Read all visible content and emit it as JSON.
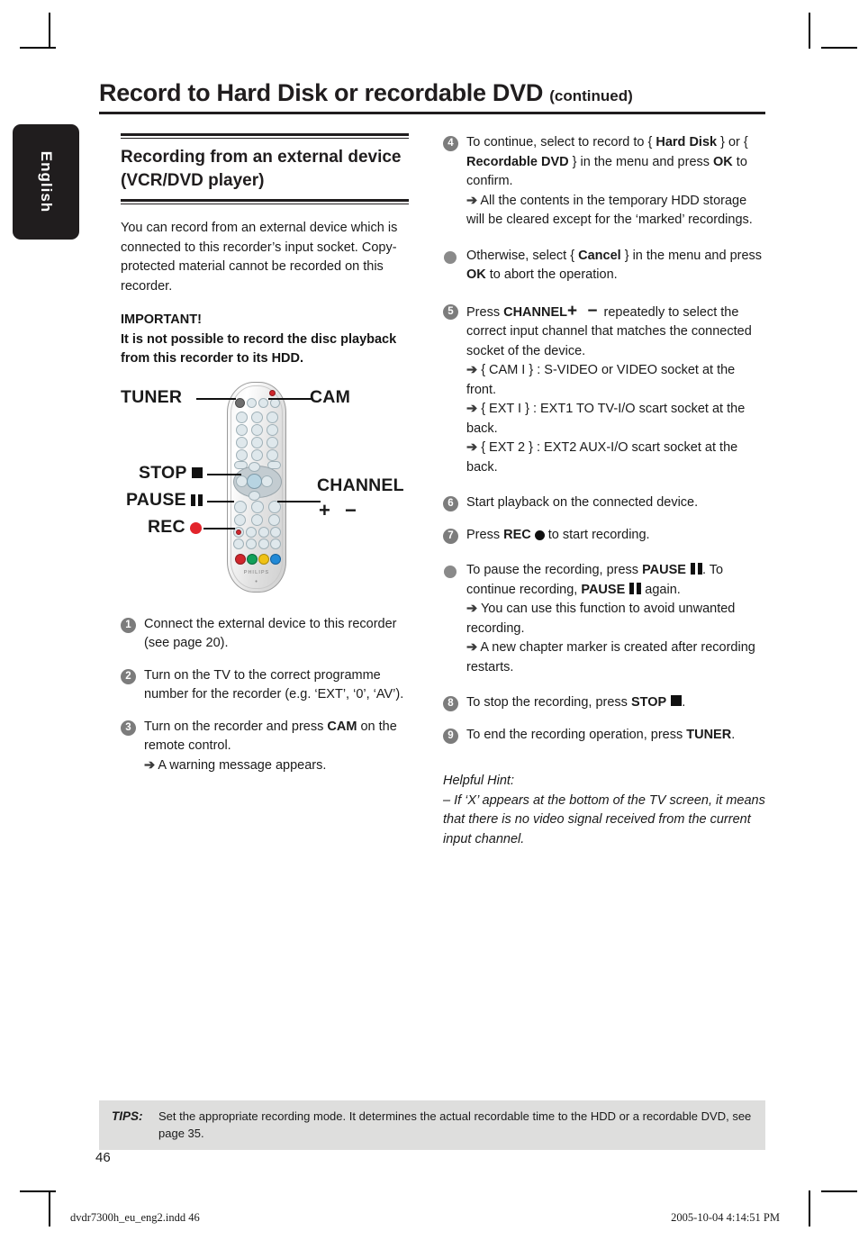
{
  "page": {
    "title": "Record to Hard Disk or recordable DVD",
    "title_suffix": "(continued)",
    "side_tab": "English",
    "page_number": "46"
  },
  "left_column": {
    "section_heading": "Recording from an external device (VCR/DVD player)",
    "intro": "You can record from an external device which is connected to this recorder’s input socket. Copy-protected material cannot be recorded on this recorder.",
    "important_label": "IMPORTANT!",
    "important_text": "It is not possible to record the disc playback from this recorder to its HDD.",
    "remote_labels": {
      "tuner": "TUNER",
      "cam": "CAM",
      "stop": "STOP",
      "pause": "PAUSE",
      "rec": "REC",
      "channel": "CHANNEL",
      "channel_plusminus": "+ −",
      "brand": "PHILIPS"
    },
    "steps": [
      {
        "number": "1",
        "text": "Connect the external device to this recorder (see page 20)."
      },
      {
        "number": "2",
        "text": "Turn on the TV to the correct programme number for the recorder (e.g. ‘EXT’, ‘0’, ‘AV’)."
      },
      {
        "number": "3",
        "text_pre": "Turn on the recorder and press ",
        "text_bold": "CAM",
        "text_post": " on the remote control.",
        "arrow_note": "A warning message appears."
      }
    ]
  },
  "right_column": {
    "step4": {
      "number": "4",
      "p1_a": "To continue, select to record to { ",
      "p1_b1": "Hard Disk",
      "p1_c": " } or { ",
      "p1_b2": "Recordable DVD",
      "p1_d": " } in the menu and press ",
      "p1_b3": "OK",
      "p1_e": " to confirm.",
      "arrow_note": "All the contents in the temporary HDD storage will be cleared except for the ‘marked’ recordings."
    },
    "bullet_cancel": {
      "a": "Otherwise, select { ",
      "b1": "Cancel",
      "c": " } in the menu and press ",
      "b2": "OK",
      "d": " to abort the operation."
    },
    "step5": {
      "number": "5",
      "a": "Press ",
      "b": "CHANNEL",
      "plusminus": "+ −",
      "c": " repeatedly to select the correct input channel that matches the connected socket of the device.",
      "notes": [
        "{ CAM I } : S-VIDEO or VIDEO socket at the front.",
        "{ EXT I } : EXT1 TO TV-I/O scart socket at the back.",
        "{ EXT 2 } : EXT2 AUX-I/O scart socket at the back."
      ]
    },
    "step6": {
      "number": "6",
      "text": "Start playback on the connected device."
    },
    "step7": {
      "number": "7",
      "a": "Press ",
      "b": "REC",
      "c": " to start recording."
    },
    "bullet_pause": {
      "a": "To pause the recording, press ",
      "b1": "PAUSE",
      "c": ". To continue recording, ",
      "b2": "PAUSE",
      "d": " again.",
      "note1": "You can use this function to avoid unwanted recording.",
      "note2": "A new chapter marker is created after recording restarts."
    },
    "step8": {
      "number": "8",
      "a": "To stop the recording, press ",
      "b": "STOP",
      "c": "."
    },
    "step9": {
      "number": "9",
      "a": "To end the recording operation, press ",
      "b": "TUNER",
      "c": "."
    },
    "hint": {
      "label": "Helpful Hint:",
      "text": "– If ‘X’ appears at the bottom of the TV screen, it means that there is no video signal received from the current input channel."
    }
  },
  "tips": {
    "label": "TIPS:",
    "text": "Set the appropriate recording mode. It determines the actual recordable time to the HDD or a recordable DVD, see page 35."
  },
  "footer": {
    "left": "dvdr7300h_eu_eng2.indd   46",
    "right": "2005-10-04   4:14:51 PM"
  },
  "colors": {
    "ink": "#201d1e",
    "marker_gray": "#7c7c7c",
    "tips_bg": "#dededd",
    "rec_red": "#e2242b"
  }
}
